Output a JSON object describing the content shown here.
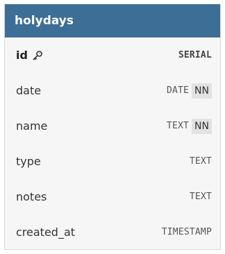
{
  "table": {
    "name": "holydays",
    "header_color": "#3d6e96",
    "columns": [
      {
        "name": "id",
        "type": "SERIAL",
        "primary_key": true,
        "key_icon": "key-icon",
        "not_null": ""
      },
      {
        "name": "date",
        "type": "DATE",
        "primary_key": false,
        "not_null": "NN"
      },
      {
        "name": "name",
        "type": "TEXT",
        "primary_key": false,
        "not_null": "NN"
      },
      {
        "name": "type",
        "type": "TEXT",
        "primary_key": false,
        "not_null": ""
      },
      {
        "name": "notes",
        "type": "TEXT",
        "primary_key": false,
        "not_null": ""
      },
      {
        "name": "created_at",
        "type": "TIMESTAMP",
        "primary_key": false,
        "not_null": ""
      }
    ]
  }
}
